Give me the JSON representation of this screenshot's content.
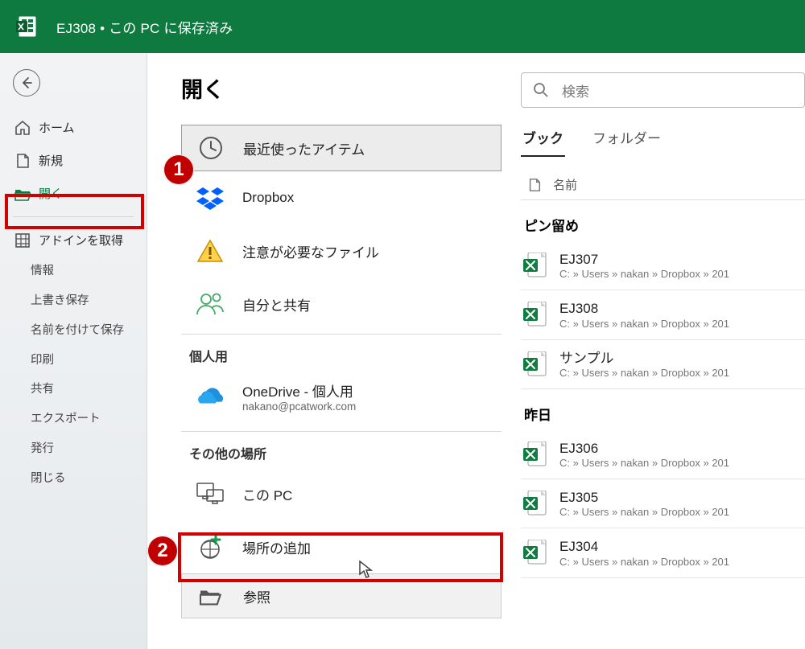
{
  "colors": {
    "brand": "#0e7a40",
    "highlight": "#d40000",
    "excel_icon": "#107c41"
  },
  "titlebar": {
    "title": "EJ308 • この PC に保存済み"
  },
  "sidebar": {
    "home": "ホーム",
    "new": "新規",
    "open": "開く",
    "addins": "アドインを取得",
    "info": "情報",
    "save": "上書き保存",
    "save_as": "名前を付けて保存",
    "print": "印刷",
    "share": "共有",
    "export": "エクスポート",
    "publish": "発行",
    "close": "閉じる"
  },
  "locations": {
    "heading": "開く",
    "recent": "最近使ったアイテム",
    "dropbox": "Dropbox",
    "attention": "注意が必要なファイル",
    "shared": "自分と共有",
    "personal_section": "個人用",
    "onedrive_title": "OneDrive - 個人用",
    "onedrive_sub": "nakano@pcatwork.com",
    "other_section": "その他の場所",
    "this_pc": "この PC",
    "add_place": "場所の追加",
    "browse": "参照"
  },
  "files_panel": {
    "search_placeholder": "検索",
    "tab_books": "ブック",
    "tab_folders": "フォルダー",
    "name_header": "名前",
    "pinned_section": "ピン留め",
    "yesterday_section": "昨日",
    "path_common": "C: » Users » nakan » Dropbox » 201",
    "pinned": [
      {
        "name": "EJ307"
      },
      {
        "name": "EJ308"
      },
      {
        "name": "サンプル"
      }
    ],
    "yesterday": [
      {
        "name": "EJ306"
      },
      {
        "name": "EJ305"
      },
      {
        "name": "EJ304"
      }
    ]
  },
  "annotations": {
    "bullet1": "1",
    "bullet2": "2"
  }
}
